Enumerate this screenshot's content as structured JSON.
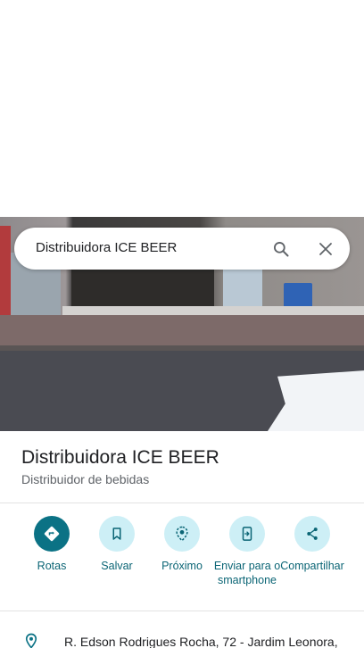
{
  "search": {
    "query": "Distribuidora ICE BEER",
    "search_icon": "search-icon",
    "close_icon": "close-icon"
  },
  "place": {
    "name": "Distribuidora ICE BEER",
    "category": "Distribuidor de bebidas"
  },
  "actions": [
    {
      "label": "Rotas",
      "icon": "directions-icon"
    },
    {
      "label": "Salvar",
      "icon": "bookmark-icon"
    },
    {
      "label": "Próximo",
      "icon": "nearby-icon"
    },
    {
      "label": "Enviar para o smartphone",
      "icon": "send-to-phone-icon"
    },
    {
      "label": "Compartilhar",
      "icon": "share-icon"
    }
  ],
  "address": {
    "text": "R. Edson Rodrigues Rocha, 72 - Jardim Leonora,",
    "icon": "location-pin-icon"
  },
  "colors": {
    "accent": "#0b7285",
    "accent_light": "#cdeff6",
    "label": "#0b6575"
  }
}
